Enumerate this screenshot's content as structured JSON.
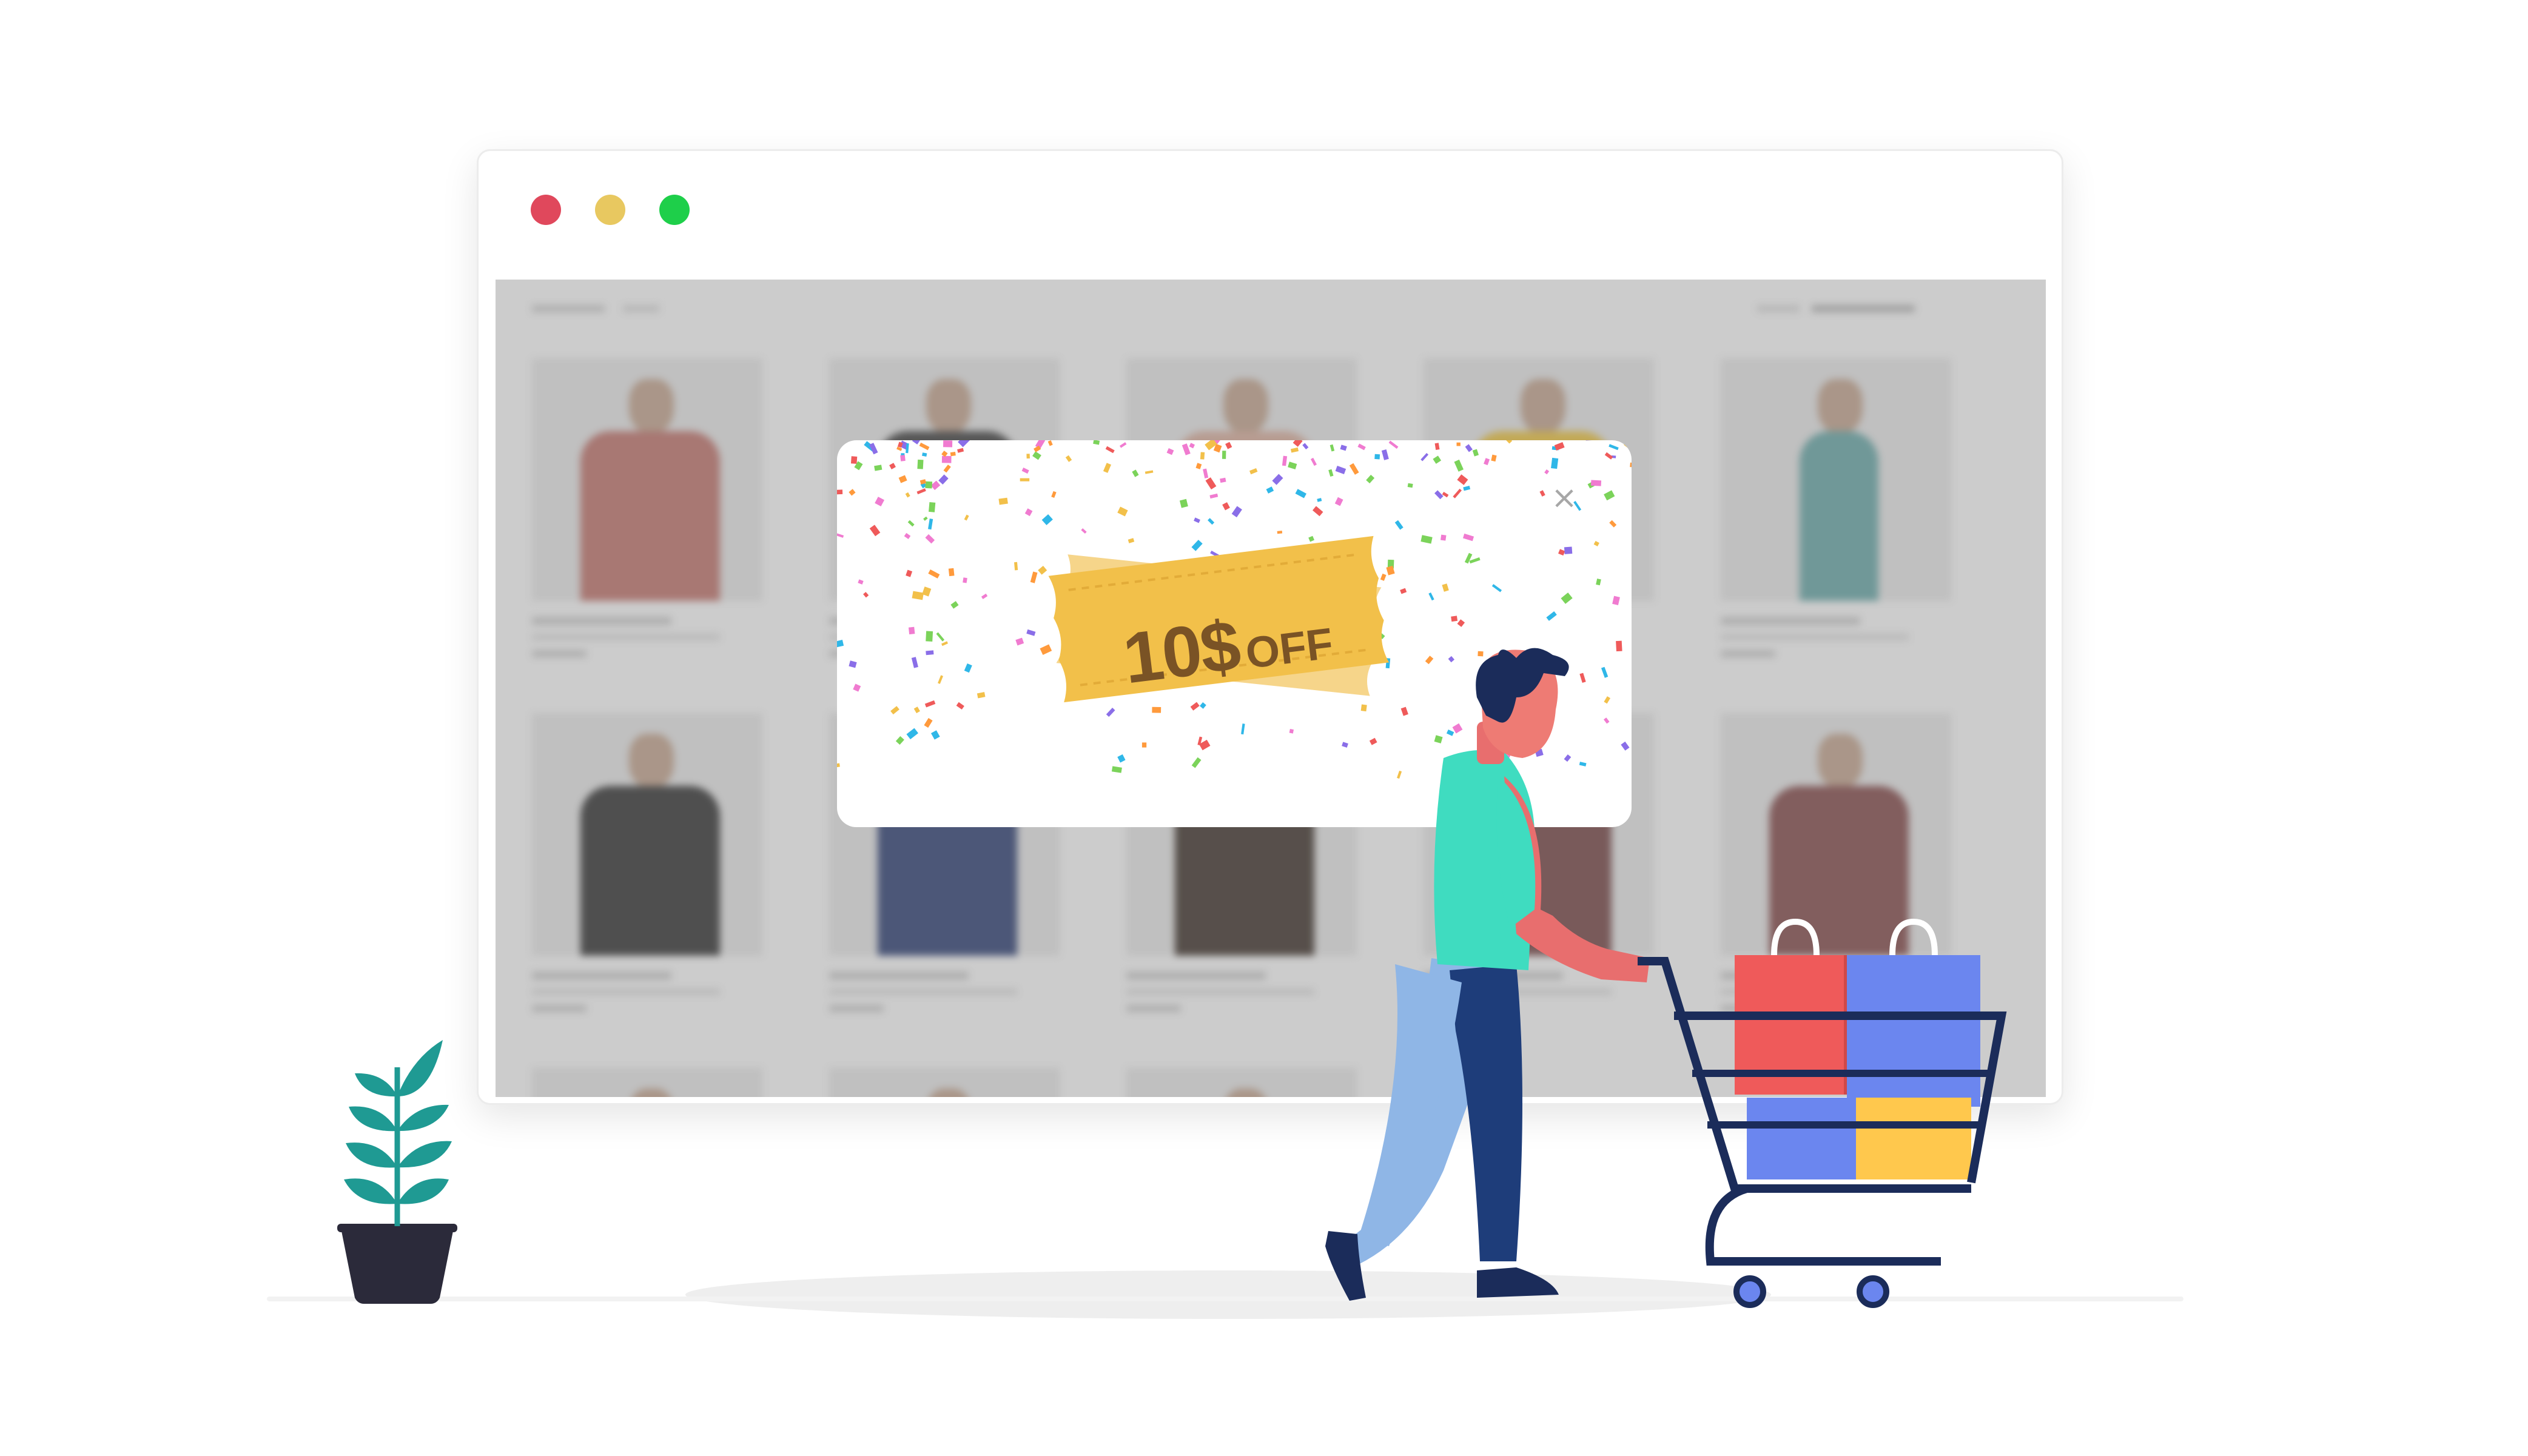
{
  "window": {
    "title_dots": [
      {
        "name": "close-dot",
        "color": "#e0485c"
      },
      {
        "name": "minimize-dot",
        "color": "#e8c860"
      },
      {
        "name": "maximize-dot",
        "color": "#1ecf4a"
      }
    ]
  },
  "page": {
    "background_color": "#e6e6e6",
    "products_row1_shirt_colors": [
      "#b16a63",
      "#3a3a3a",
      "#c8a090",
      "#d8b33a",
      "#5f9a9a"
    ],
    "products_row2_shirt_colors": [
      "#2f2f2f",
      "#2a3a6a",
      "#3a2f28",
      "#6c3f3f",
      "#7a4444"
    ]
  },
  "popup": {
    "coupon": {
      "amount": "10$",
      "off_label": "OFF",
      "front_color": "#f2c04a",
      "back_color": "#f6d58a",
      "text_color": "#7a5325"
    },
    "close_icon": "close-icon",
    "close_glyph": "×"
  },
  "illustration": {
    "shirt_color": "#3fdcc0",
    "pants_front_color": "#8fb6e6",
    "pants_back_color": "#1e3d7a",
    "hair_color": "#1b2c5a",
    "cart_color": "#1b2c5a",
    "bag_red_color": "#ef5a5a",
    "bag_blue_color": "#6b86ef",
    "box_yellow_color": "#ffc84d",
    "plant_leaf_color": "#1f9a93",
    "pot_color": "#2b2a3a"
  }
}
